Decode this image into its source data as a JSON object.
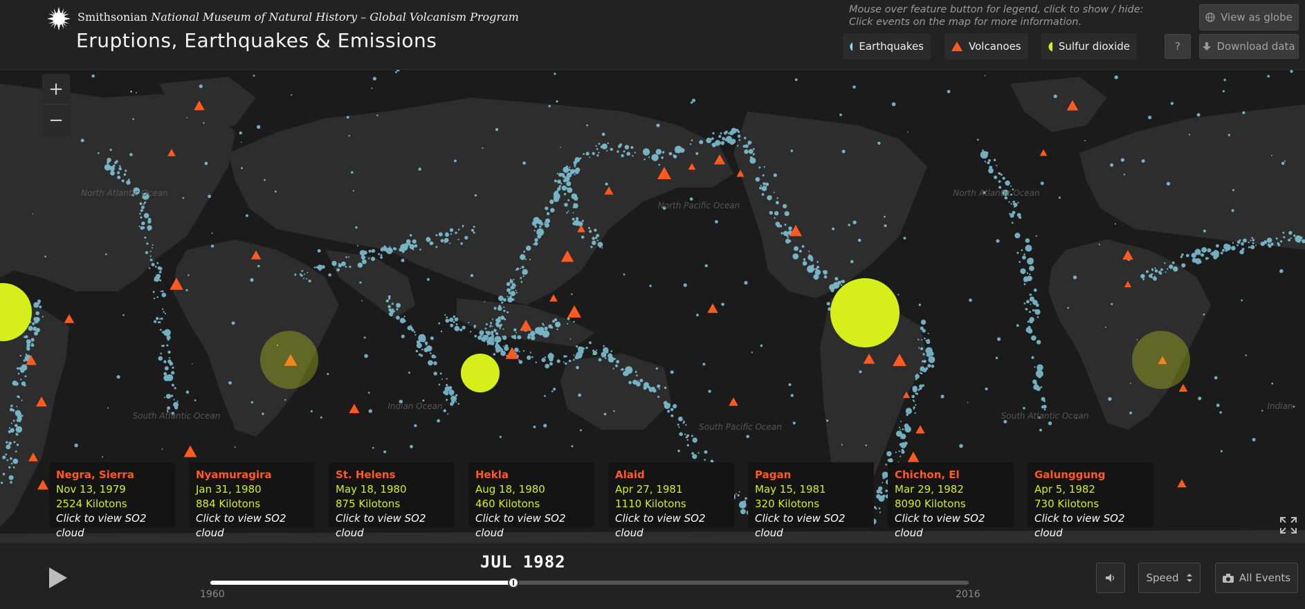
{
  "header": {
    "org_plain": "Smithsonian ",
    "org_italic": "National Museum of Natural History – Global Volcanism Program",
    "title": "Eruptions, Earthquakes & Emissions",
    "hint_line1": "Mouse over feature button for legend, click to show / hide:",
    "hint_line2": "Click events on the map for more information."
  },
  "legend": [
    {
      "label": "Earthquakes",
      "icon": "circle-icon",
      "color": "#8fe0f7"
    },
    {
      "label": "Volcanoes",
      "icon": "triangle-icon",
      "color": "#ff5a1f"
    },
    {
      "label": "Sulfur dioxide",
      "icon": "circle-icon",
      "color": "#d6ee1a"
    }
  ],
  "buttons": {
    "view_globe": "View as globe",
    "help": "?",
    "download": "Download data"
  },
  "map": {
    "zoom_in": "+",
    "zoom_out": "−",
    "ocean_labels": [
      "North Atlantic Ocean",
      "North Pacific Ocean",
      "South Atlantic Ocean",
      "Indian Ocean",
      "South Pacific Ocean",
      "North Atlantic Ocean",
      "South Atlantic Ocean",
      "Indian"
    ]
  },
  "events": [
    {
      "name": "Negra, Sierra",
      "date": "Nov 13, 1979",
      "kilotons": "2524 Kilotons",
      "link": "Click to view SO2 cloud"
    },
    {
      "name": "Nyamuragira",
      "date": "Jan 31, 1980",
      "kilotons": "884 Kilotons",
      "link": "Click to view SO2 cloud"
    },
    {
      "name": "St. Helens",
      "date": "May 18, 1980",
      "kilotons": "875 Kilotons",
      "link": "Click to view SO2 cloud"
    },
    {
      "name": "Hekla",
      "date": "Aug 18, 1980",
      "kilotons": "460 Kilotons",
      "link": "Click to view SO2 cloud"
    },
    {
      "name": "Alaid",
      "date": "Apr 27, 1981",
      "kilotons": "1110 Kilotons",
      "link": "Click to view SO2 cloud"
    },
    {
      "name": "Pagan",
      "date": "May 15, 1981",
      "kilotons": "320 Kilotons",
      "link": "Click to view SO2 cloud"
    },
    {
      "name": "Chichon, El",
      "date": "Mar 29, 1982",
      "kilotons": "8090 Kilotons",
      "link": "Click to view SO2 cloud"
    },
    {
      "name": "Galunggung",
      "date": "Apr 5, 1982",
      "kilotons": "730 Kilotons",
      "link": "Click to view SO2 cloud"
    }
  ],
  "timeline": {
    "current_date": "JUL  1982",
    "start_year": "1960",
    "end_year": "2016",
    "progress": 0.4,
    "speed_label": "Speed",
    "all_events_label": "All Events"
  },
  "colors": {
    "earthquake": "#8fe0f7",
    "volcano": "#ff5a1f",
    "so2": "#d6ee1a"
  }
}
